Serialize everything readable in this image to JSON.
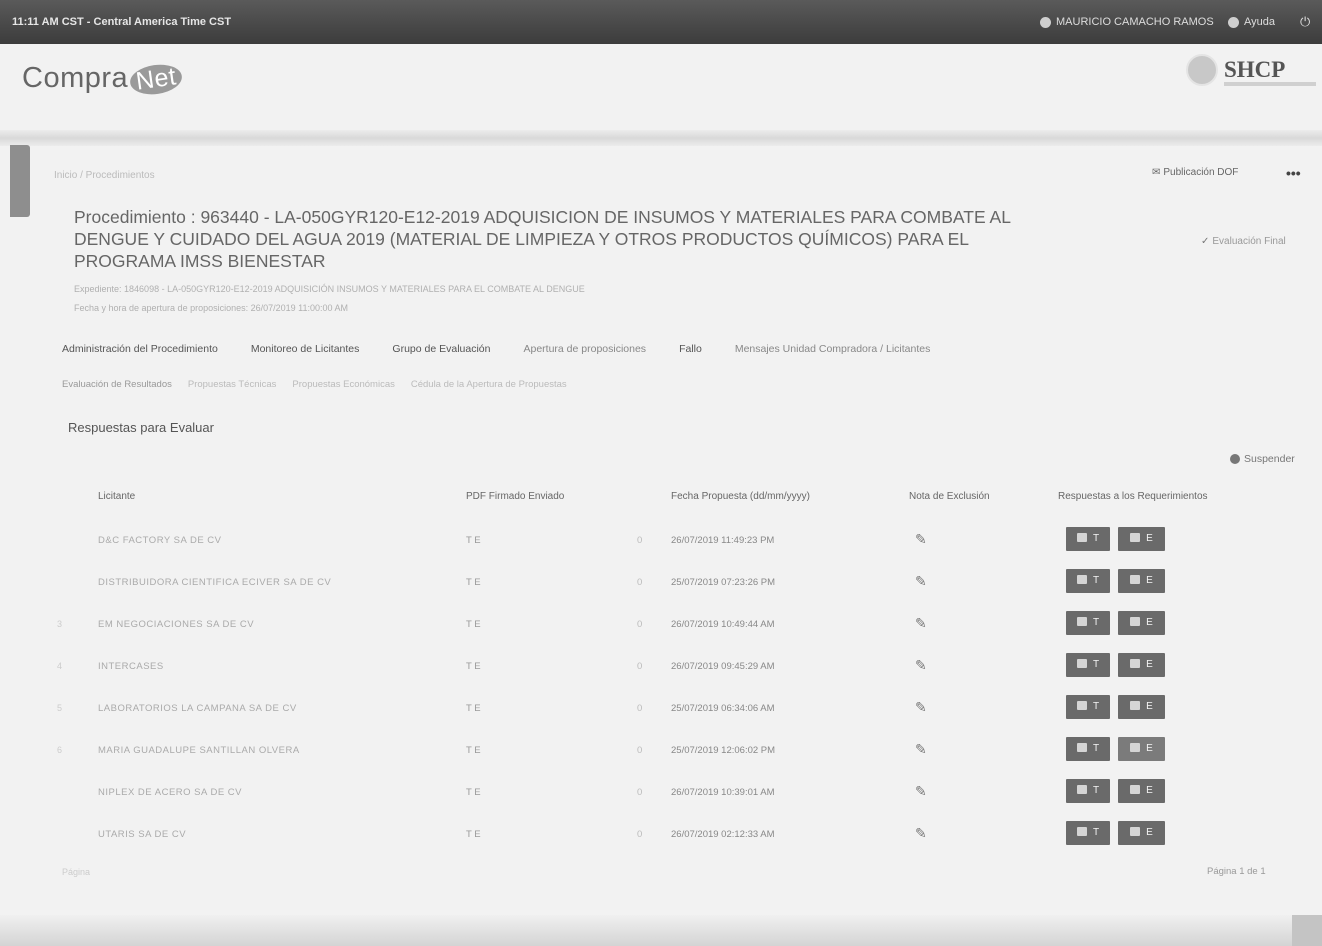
{
  "topbar": {
    "clock": "11:11 AM CST - Central America Time CST",
    "user": "MAURICIO CAMACHO RAMOS",
    "help": "Ayuda"
  },
  "brand": {
    "logo_left": "Compra",
    "logo_right": "Net",
    "shcp": "SHCP"
  },
  "breadcrumb": "Inicio  /  Procedimientos",
  "actions": {
    "publicacion_dof": "Publicación DOF",
    "more": "•••",
    "evaluacion_final": "Evaluación Final"
  },
  "procedure": {
    "title": "Procedimiento : 963440 - LA-050GYR120-E12-2019 ADQUISICION DE INSUMOS Y MATERIALES PARA COMBATE AL DENGUE Y CUIDADO DEL AGUA 2019 (MATERIAL DE LIMPIEZA Y OTROS PRODUCTOS QUÍMICOS) PARA EL PROGRAMA IMSS BIENESTAR",
    "expediente": "Expediente: 1846098 - LA-050GYR120-E12-2019 ADQUISICIÓN INSUMOS Y MATERIALES PARA EL COMBATE AL DENGUE",
    "apertura": "Fecha y hora de apertura de proposiciones:  26/07/2019 11:00:00 AM"
  },
  "tabs_main": [
    "Administración del Procedimiento",
    "Monitoreo de Licitantes",
    "Grupo de Evaluación",
    "Apertura de proposiciones",
    "Fallo",
    "Mensajes Unidad Compradora / Licitantes"
  ],
  "tabs_sub": [
    "Evaluación de Resultados",
    "Propuestas Técnicas",
    "Propuestas Económicas",
    "Cédula de la Apertura de Propuestas"
  ],
  "section_title": "Respuestas para Evaluar",
  "suspend": "Suspender",
  "table": {
    "headers": [
      "Licitante",
      "PDF Firmado Enviado",
      "Fecha Propuesta (dd/mm/yyyy)",
      "Nota de Exclusión",
      "Respuestas a los Requerimientos"
    ],
    "rows": [
      {
        "num": "",
        "name": "D&C FACTORY SA DE CV",
        "pdf": "T E",
        "count": "0",
        "date": "26/07/2019 11:49:23 PM"
      },
      {
        "num": "",
        "name": "DISTRIBUIDORA CIENTIFICA ECIVER SA DE CV",
        "pdf": "T E",
        "count": "0",
        "date": "25/07/2019 07:23:26 PM"
      },
      {
        "num": "3",
        "name": "EM NEGOCIACIONES SA DE CV",
        "pdf": "T E",
        "count": "0",
        "date": "26/07/2019 10:49:44 AM"
      },
      {
        "num": "4",
        "name": "INTERCASES",
        "pdf": "T E",
        "count": "0",
        "date": "26/07/2019 09:45:29 AM"
      },
      {
        "num": "5",
        "name": "LABORATORIOS LA CAMPANA SA DE CV",
        "pdf": "T E",
        "count": "0",
        "date": "25/07/2019 06:34:06 AM"
      },
      {
        "num": "6",
        "name": "MARIA GUADALUPE SANTILLAN OLVERA",
        "pdf": "T E",
        "count": "0",
        "date": "25/07/2019 12:06:02 PM"
      },
      {
        "num": "",
        "name": "NIPLEX DE ACERO SA DE CV",
        "pdf": "T E",
        "count": "0",
        "date": "26/07/2019 10:39:01 AM"
      },
      {
        "num": "",
        "name": "UTARIS SA DE CV",
        "pdf": "T E",
        "count": "0",
        "date": "26/07/2019 02:12:33 AM"
      }
    ],
    "btn_t": "T",
    "btn_e": "E",
    "note_icon": "✎"
  },
  "footer": {
    "left": "Página",
    "right": "Página 1 de 1"
  }
}
